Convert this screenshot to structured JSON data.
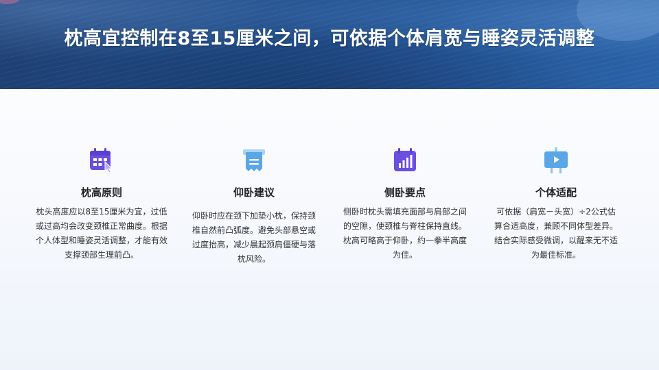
{
  "header": {
    "title": "枕高宜控制在8至15厘米之间，可依据个体肩宽与睡姿灵活调整"
  },
  "cards": [
    {
      "icon": "calendar-pointer-icon",
      "title": "枕高原则",
      "text": "枕头高度应以8至15厘米为宜，过低或过高均会改变颈椎正常曲度。根据个人体型和睡姿灵活调整，才能有效支撑颈部生理前凸。"
    },
    {
      "icon": "document-list-icon",
      "title": "仰卧建议",
      "text": "仰卧时应在颈下加垫小枕，保持颈椎自然前凸弧度。避免头部悬空或过度抬高，减少晨起颈肩僵硬与落枕风险。"
    },
    {
      "icon": "bar-chart-calendar-icon",
      "title": "侧卧要点",
      "text": "侧卧时枕头需填充面部与肩部之间的空隙，使颈椎与脊柱保持直线。枕高可略高于仰卧，约一拳半高度为佳。"
    },
    {
      "icon": "presentation-screen-icon",
      "title": "个体适配",
      "text": "可依据（肩宽－头宽）÷2公式估算合适高度，兼顾不同体型差异。结合实际感受微调，以醒来无不适为最佳标准。"
    }
  ],
  "colors": {
    "banner": "#1d4a86",
    "icon_purple": "#6a4fe0",
    "icon_blue": "#5aa6e6"
  }
}
